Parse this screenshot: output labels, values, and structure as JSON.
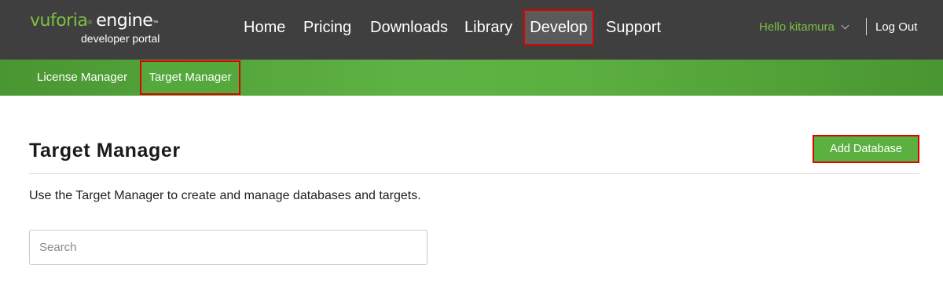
{
  "logo": {
    "brand": "vuforia",
    "reg_mark": "®",
    "product": "engine",
    "tm_mark": "™",
    "subtitle": "developer portal"
  },
  "main_nav": {
    "home": "Home",
    "pricing": "Pricing",
    "downloads": "Downloads",
    "library": "Library",
    "develop": "Develop",
    "support": "Support",
    "active": "Develop"
  },
  "user": {
    "greeting": "Hello kitamura",
    "logout": "Log Out"
  },
  "sub_nav": {
    "license_manager": "License Manager",
    "target_manager": "Target Manager",
    "active": "Target Manager"
  },
  "content": {
    "title": "Target Manager",
    "add_button": "Add Database",
    "intro": "Use the Target Manager to create and manage databases and targets.",
    "search_placeholder": "Search",
    "search_value": ""
  },
  "colors": {
    "header_bg": "#3f3f3f",
    "brand_green": "#7dc142",
    "subnav_green": "#5fb344",
    "button_green": "#5cb040",
    "highlight_red": "#e00000"
  },
  "icons": {
    "user_dropdown": "chevron-down-icon"
  }
}
